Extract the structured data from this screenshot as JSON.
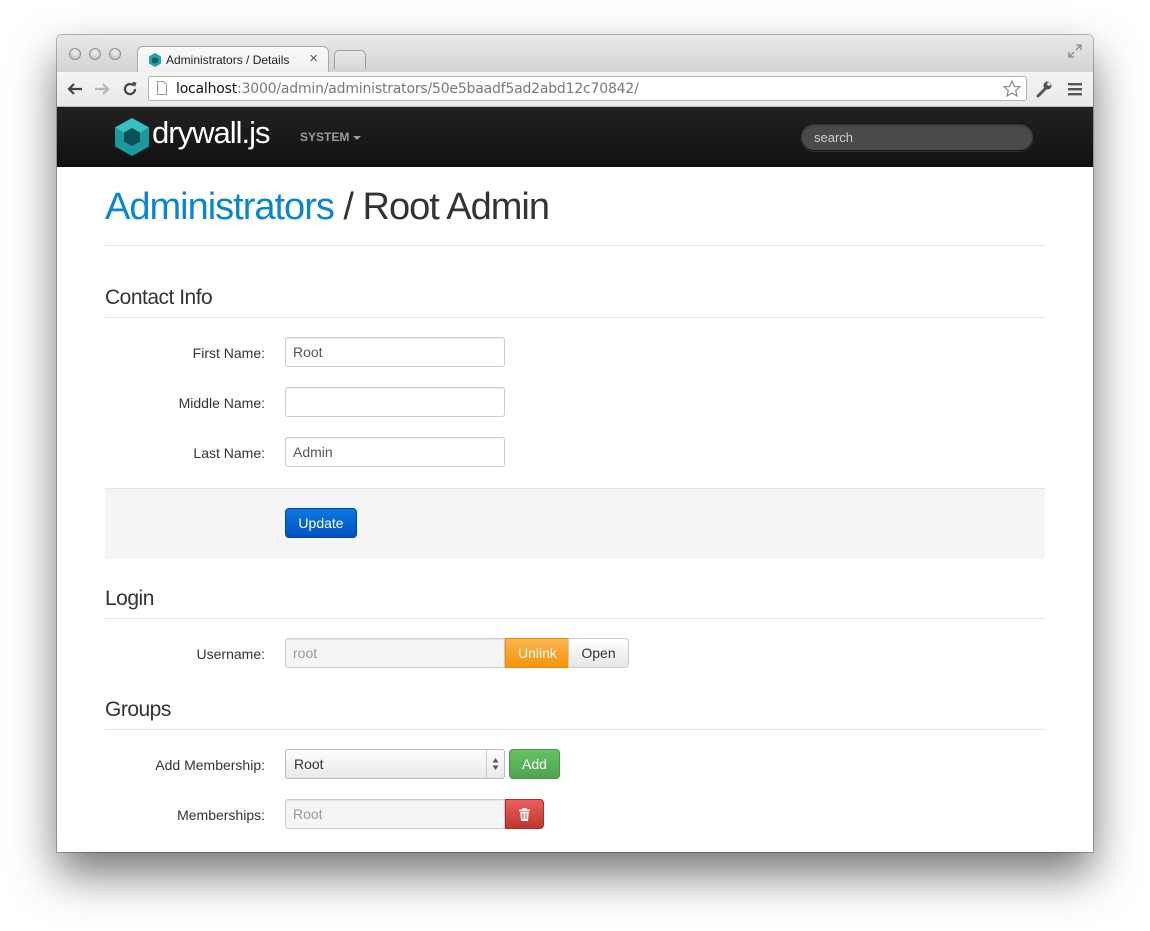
{
  "browser": {
    "tab_title": "Administrators / Details",
    "tab_close": "×",
    "url_host": "localhost",
    "url_path": ":3000/admin/administrators/50e5baadf5ad2abd12c70842/"
  },
  "navbar": {
    "brand": "drywall.js",
    "menu_label": "SYSTEM",
    "search_placeholder": "search"
  },
  "header": {
    "parent_link": "Administrators",
    "separator": " / ",
    "title": "Root Admin"
  },
  "contact": {
    "section_title": "Contact Info",
    "first_name_label": "First Name:",
    "first_name_value": "Root",
    "middle_name_label": "Middle Name:",
    "middle_name_value": "",
    "last_name_label": "Last Name:",
    "last_name_value": "Admin",
    "update_label": "Update"
  },
  "login": {
    "section_title": "Login",
    "username_label": "Username:",
    "username_value": "root",
    "unlink_label": "Unlink",
    "open_label": "Open"
  },
  "groups": {
    "section_title": "Groups",
    "add_membership_label": "Add Membership:",
    "add_membership_selected": "Root",
    "add_label": "Add",
    "memberships_label": "Memberships:",
    "membership_value": "Root"
  },
  "colors": {
    "link_blue": "#0a87c8",
    "primary": "#0066d6",
    "warning": "#f89406",
    "success": "#51a351",
    "danger": "#bd362f",
    "navbar": "#1b1b1b"
  }
}
